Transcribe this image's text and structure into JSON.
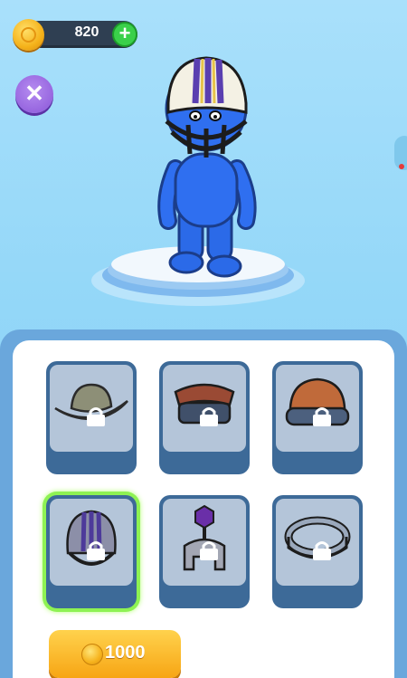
{
  "currency": {
    "coins": "820",
    "add_label": "+"
  },
  "close_label": "✕",
  "shop": {
    "items": [
      {
        "icon": "cowboy-hat-icon",
        "locked": true,
        "selected": false
      },
      {
        "icon": "beanie-hat-icon",
        "locked": true,
        "selected": false
      },
      {
        "icon": "goggle-helmet-icon",
        "locked": true,
        "selected": false
      },
      {
        "icon": "football-helmet-icon",
        "locked": true,
        "selected": true
      },
      {
        "icon": "plume-helmet-icon",
        "locked": true,
        "selected": false
      },
      {
        "icon": "ring-band-icon",
        "locked": true,
        "selected": false
      }
    ],
    "buy_price": "1000"
  },
  "colors": {
    "character": "#2f6ff0",
    "panel": "#6aa7dc",
    "buy_button": "#f7a514",
    "selected_outline": "#8ef253"
  }
}
